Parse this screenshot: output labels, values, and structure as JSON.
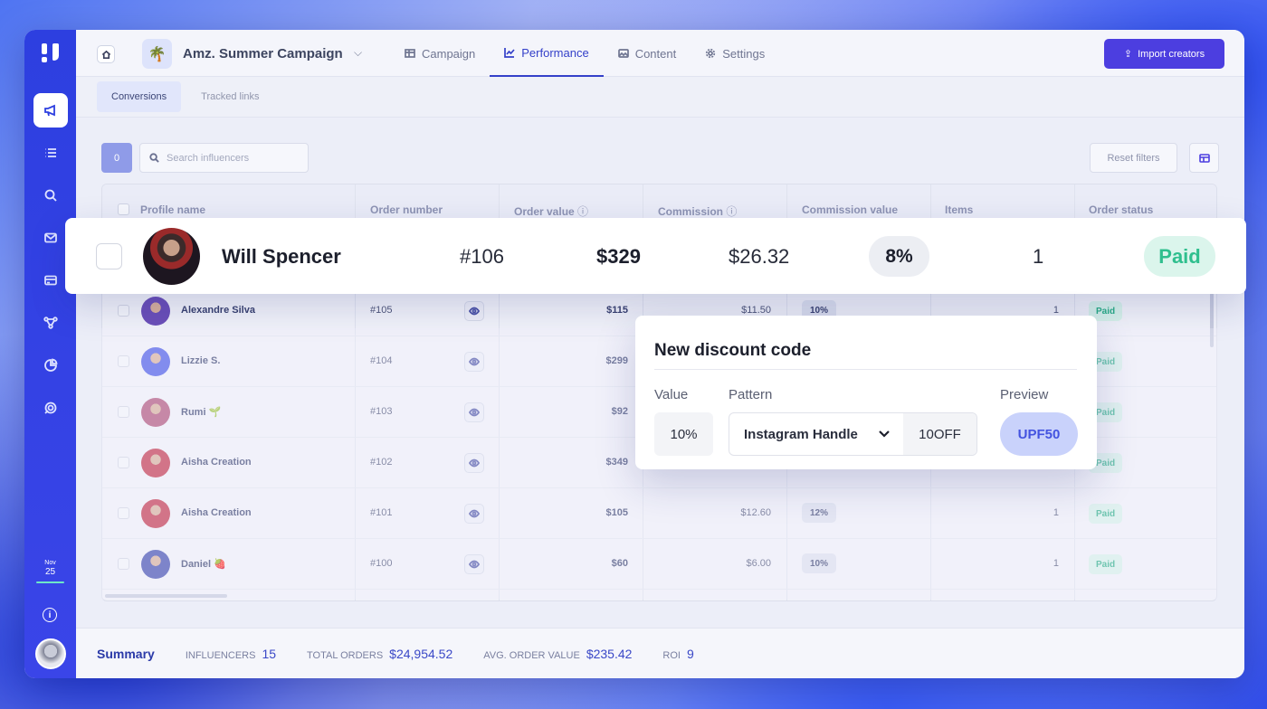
{
  "campaign": {
    "title": "Amz. Summer Campaign"
  },
  "tabs": [
    {
      "label": "Campaign",
      "icon": "table-icon"
    },
    {
      "label": "Performance",
      "icon": "chart-icon",
      "active": true
    },
    {
      "label": "Content",
      "icon": "image-icon"
    },
    {
      "label": "Settings",
      "icon": "gear-icon"
    }
  ],
  "import_button": "Import creators",
  "subtabs": [
    "Conversions",
    "Tracked links"
  ],
  "toolbar": {
    "count": "0",
    "search_placeholder": "Search influencers",
    "reset": "Reset filters"
  },
  "columns": [
    "Profile name",
    "Order number",
    "Order value",
    "Commission",
    "Commission value",
    "Items",
    "Order status"
  ],
  "highlight_row": {
    "name": "Will Spencer",
    "order": "#106",
    "value": "$329",
    "commission": "$26.32",
    "rate": "8%",
    "items": "1",
    "status": "Paid"
  },
  "rows": [
    {
      "name": "Alexandre Silva",
      "order": "#105",
      "value": "$115",
      "commission": "$11.50",
      "rate": "10%",
      "items": "1",
      "status": "Paid",
      "avatar_color": "#6b4fb8"
    },
    {
      "name": "Lizzie S.",
      "order": "#104",
      "value": "$299",
      "commission": "",
      "rate": "",
      "items": "",
      "status": "Paid",
      "avatar_color": "#4857e6"
    },
    {
      "name": "Rumi 🌱",
      "order": "#103",
      "value": "$92",
      "commission": "",
      "rate": "",
      "items": "",
      "status": "Paid",
      "avatar_color": "#b0507a"
    },
    {
      "name": "Aisha Creation",
      "order": "#102",
      "value": "$349",
      "commission": "",
      "rate": "",
      "items": "",
      "status": "Paid",
      "avatar_color": "#c2324a"
    },
    {
      "name": "Aisha Creation",
      "order": "#101",
      "value": "$105",
      "commission": "$12.60",
      "rate": "12%",
      "items": "1",
      "status": "Paid",
      "avatar_color": "#c2324a"
    },
    {
      "name": "Daniel 🍓",
      "order": "#100",
      "value": "$60",
      "commission": "$6.00",
      "rate": "10%",
      "items": "1",
      "status": "Paid",
      "avatar_color": "#3f4bb0"
    }
  ],
  "popup": {
    "title": "New discount code",
    "value_label": "Value",
    "pattern_label": "Pattern",
    "preview_label": "Preview",
    "value": "10%",
    "pattern": "Instagram Handle",
    "suffix": "10OFF",
    "preview": "UPF50"
  },
  "summary": {
    "title": "Summary",
    "items": [
      {
        "label": "Influencers",
        "value": "15"
      },
      {
        "label": "Total orders",
        "value": "$24,954.52"
      },
      {
        "label": "Avg. order value",
        "value": "$235.42"
      },
      {
        "label": "ROI",
        "value": "9"
      }
    ]
  },
  "sidebar": {
    "date": "25",
    "date_top": "Nov"
  },
  "colors": {
    "brand": "#2d3fe0",
    "accent": "#4c3ee0",
    "paid": "#2fbf8e"
  }
}
